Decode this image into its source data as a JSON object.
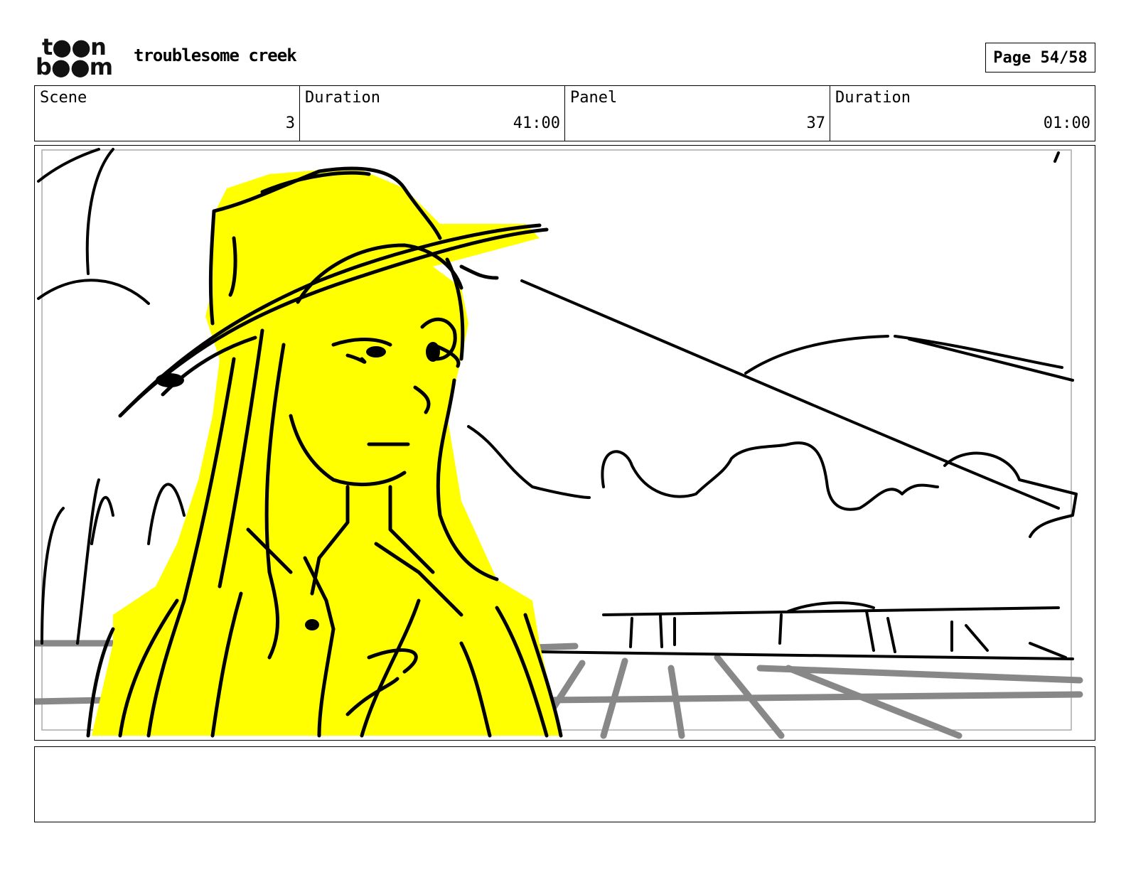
{
  "logo": {
    "line1": "t●●n",
    "line2": "b●●m"
  },
  "project_title": "troublesome creek",
  "page_label": "Page 54/58",
  "info": {
    "scene_label": "Scene",
    "scene_value": "3",
    "scene_duration_label": "Duration",
    "scene_duration_value": "41:00",
    "panel_label": "Panel",
    "panel_value": "37",
    "panel_duration_label": "Duration",
    "panel_duration_value": "01:00"
  },
  "colors": {
    "highlight": "#ffff00",
    "ink": "#000000",
    "ground_lines": "#888888",
    "border": "#000000"
  },
  "notes": ""
}
